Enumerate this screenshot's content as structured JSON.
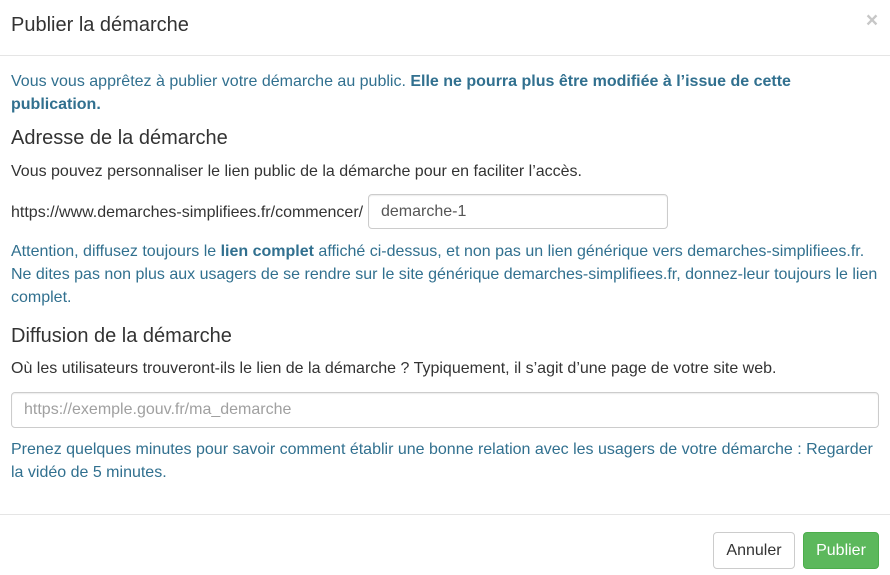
{
  "header": {
    "title": "Publier la démarche",
    "close_label": "×"
  },
  "info": {
    "text": "Vous vous apprêtez à publier votre démarche au public. ",
    "strong": "Elle ne pourra plus être modifiée à l’issue de cette publication."
  },
  "address": {
    "heading": "Adresse de la démarche",
    "description": "Vous pouvez personnaliser le lien public de la démarche pour en faciliter l’accès.",
    "url_prefix": "https://www.demarches-simplifiees.fr/commencer/",
    "path_value": "demarche-1"
  },
  "warning": {
    "part1": "Attention, diffusez toujours le ",
    "strong": "lien complet",
    "part2": " affiché ci-dessus, et non pas un lien générique vers demarches-simplifiees.fr. Ne dites pas non plus aux usagers de se rendre sur le site générique demarches-simplifiees.fr, donnez-leur toujours le lien complet."
  },
  "diffusion": {
    "heading": "Diffusion de la démarche",
    "description": "Où les utilisateurs trouveront-ils le lien de la démarche ? Typiquement, il s’agit d’une page de votre site web.",
    "placeholder": "https://exemple.gouv.fr/ma_demarche",
    "value": ""
  },
  "tip": {
    "text": "Prenez quelques minutes pour savoir comment établir une bonne relation avec les usagers de votre démarche : ",
    "link": "Regarder la vidéo de 5 minutes."
  },
  "footer": {
    "cancel_label": "Annuler",
    "publish_label": "Publier"
  },
  "colors": {
    "info_text": "#31708f",
    "publish_button": "#5cb85c",
    "border": "#e5e5e5"
  }
}
